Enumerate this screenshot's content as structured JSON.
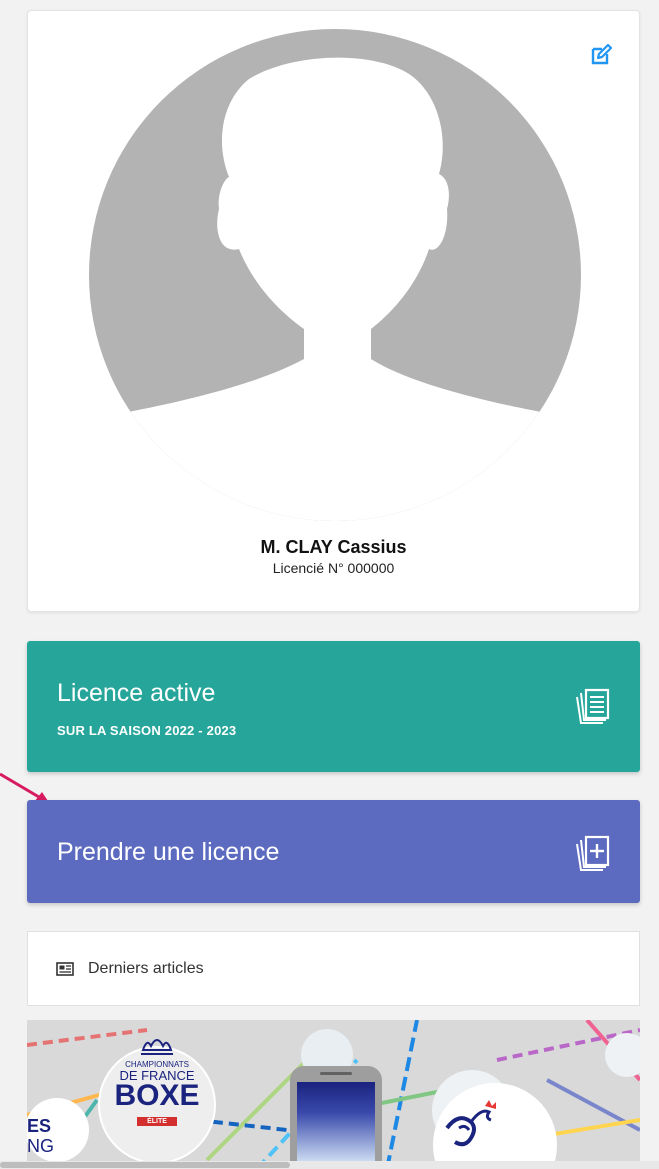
{
  "profile": {
    "name": "M. CLAY Cassius",
    "licence_number": "Licencié N° 000000"
  },
  "licence_active": {
    "title": "Licence active",
    "season": "SUR LA SAISON 2022 - 2023"
  },
  "take_licence": {
    "title": "Prendre une licence"
  },
  "articles": {
    "label": "Derniers articles"
  },
  "article_banner": {
    "line1": "CHAMPIONNATS",
    "line2": "DE FRANCE",
    "line3": "BOXE",
    "badge": "ÉLITE",
    "edge_text_1": "ES",
    "edge_text_2": "NG"
  },
  "colors": {
    "teal": "#26a69a",
    "indigo": "#5c6bc0",
    "edit_blue": "#2196f3",
    "arrow_pink": "#d81b60",
    "avatar_gray": "#b3b3b3"
  },
  "icons": {
    "edit": "edit-icon",
    "licence_document": "document-stack-icon",
    "add_licence": "add-document-icon",
    "articles": "newspaper-icon",
    "arrow": "arrow-pointer-icon"
  }
}
